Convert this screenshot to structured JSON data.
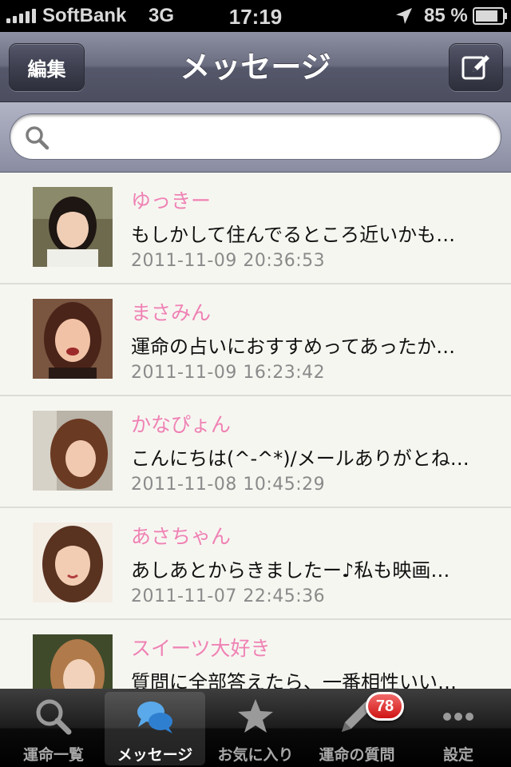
{
  "status_bar": {
    "carrier": "SoftBank",
    "network": "3G",
    "time": "17:19",
    "battery": "85 %",
    "icons": [
      "signal-bars-icon",
      "location-arrow-icon",
      "battery-icon"
    ]
  },
  "nav": {
    "edit_label": "編集",
    "title": "メッセージ",
    "compose_icon": "compose-icon"
  },
  "search": {
    "placeholder": "",
    "icon": "search-icon"
  },
  "messages": [
    {
      "name": "ゆっきー",
      "preview": "もしかして住んでるところ近いかも…",
      "time": "2011-11-09 20:36:53"
    },
    {
      "name": "まさみん",
      "preview": "運命の占いにおすすめってあったか…",
      "time": "2011-11-09 16:23:42"
    },
    {
      "name": "かなぴょん",
      "preview": "こんにちは(^-^*)/メールありがとね…",
      "time": "2011-11-08 10:45:29"
    },
    {
      "name": "あさちゃん",
      "preview": "あしあとからきましたー♪私も映画…",
      "time": "2011-11-07 22:45:36"
    },
    {
      "name": "スイーツ大好き",
      "preview": "質問に全部答えたら、一番相性いい…",
      "time": ""
    }
  ],
  "tabs": [
    {
      "label": "運命一覧",
      "icon": "magnifier-icon",
      "active": false
    },
    {
      "label": "メッセージ",
      "icon": "chat-bubbles-icon",
      "active": true
    },
    {
      "label": "お気に入り",
      "icon": "star-icon",
      "active": false
    },
    {
      "label": "運命の質問",
      "icon": "pencil-icon",
      "active": false,
      "badge": "78"
    },
    {
      "label": "設定",
      "icon": "more-dots-icon",
      "active": false
    }
  ],
  "colors": {
    "name_pink": "#ef82b4",
    "badge_red": "#d01414"
  }
}
